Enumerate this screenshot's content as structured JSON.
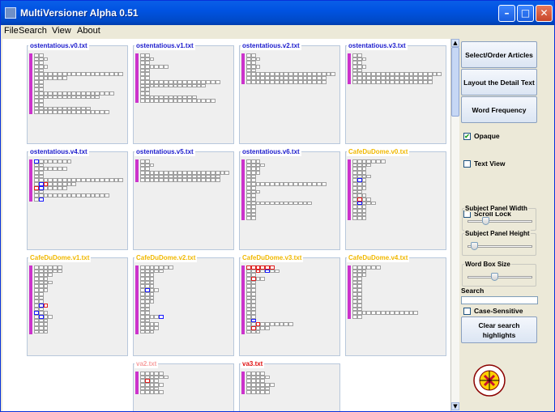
{
  "window": {
    "title": "MultiVersioner Alpha 0.51",
    "min_label": "–",
    "max_label": "□",
    "close_label": "✕"
  },
  "menu": [
    {
      "label": "File"
    },
    {
      "label": "Search"
    },
    {
      "label": "View"
    },
    {
      "label": "About"
    }
  ],
  "colors": {
    "blue_title": "#1a1acc",
    "yellow_title": "#f0b800",
    "pink_title": "#f7a0a0",
    "red_title": "#e01010",
    "marker": "#cc33cc"
  },
  "panels": [
    {
      "title": "ostentatious.v0.txt",
      "title_color": "blue",
      "rows": [
        [
          2
        ],
        [
          3
        ],
        [
          2
        ],
        [
          3
        ],
        [
          2
        ],
        [
          19
        ],
        [
          7
        ],
        [
          2
        ],
        [
          2
        ],
        [
          2
        ],
        [
          17
        ],
        [
          14
        ],
        [
          2
        ],
        [
          2
        ],
        [
          12
        ],
        [
          16
        ]
      ]
    },
    {
      "title": "ostentatious.v1.txt",
      "title_color": "blue",
      "rows": [
        [
          2
        ],
        [
          3
        ],
        [
          2
        ],
        [
          6
        ],
        [
          2,
          "b"
        ],
        [
          2
        ],
        [
          2
        ],
        [
          17
        ],
        [
          14
        ],
        [
          2
        ],
        [
          2
        ],
        [
          12
        ],
        [
          16
        ]
      ]
    },
    {
      "title": "ostentatious.v2.txt",
      "title_color": "blue",
      "rows": [
        [
          2
        ],
        [
          3
        ],
        [
          2
        ],
        [
          3
        ],
        [
          2
        ],
        [
          19
        ],
        [
          17
        ],
        [
          17
        ]
      ]
    },
    {
      "title": "ostentatious.v3.txt",
      "title_color": "blue",
      "rows": [
        [
          2
        ],
        [
          3
        ],
        [
          2
        ],
        [
          3
        ],
        [
          2
        ],
        [
          19
        ],
        [
          17
        ],
        [
          17
        ]
      ]
    },
    {
      "title": "ostentatious.v4.txt",
      "title_color": "blue",
      "rows": [
        [
          8,
          "b1"
        ],
        [
          2
        ],
        [
          7
        ],
        [
          2
        ],
        [
          2
        ],
        [
          19
        ],
        [
          9,
          "b2r3"
        ],
        [
          7,
          "r1b2"
        ],
        [
          2
        ],
        [
          16
        ],
        [
          2,
          "b2"
        ]
      ]
    },
    {
      "title": "ostentatious.v5.txt",
      "title_color": "blue",
      "rows": [
        [
          2
        ],
        [
          3
        ],
        [
          2
        ],
        [
          19
        ],
        [
          17
        ],
        [
          17
        ]
      ]
    },
    {
      "title": "ostentatious.v6.txt",
      "title_color": "blue",
      "rows": [
        [
          3
        ],
        [
          4
        ],
        [
          3
        ],
        [
          3
        ],
        [
          2
        ],
        [
          2
        ],
        [
          17
        ],
        [
          2
        ],
        [
          3
        ],
        [
          2
        ],
        [
          2
        ],
        [
          14
        ],
        [
          2
        ],
        [
          2
        ],
        [
          2
        ],
        [
          2
        ]
      ]
    },
    {
      "title": "CafeDuDome.v0.txt",
      "title_color": "yellow",
      "rows": [
        [
          7
        ],
        [
          4
        ],
        [
          3
        ],
        [
          3
        ],
        [
          4
        ],
        [
          3,
          "b2"
        ],
        [
          3
        ],
        [
          3
        ],
        [
          2
        ],
        [
          3
        ],
        [
          4,
          "r2"
        ],
        [
          5,
          "b2"
        ],
        [
          3
        ],
        [
          3
        ],
        [
          3
        ],
        [
          3
        ]
      ]
    },
    {
      "title": "CafeDuDome.v1.txt",
      "title_color": "yellow",
      "rows": [
        [
          6
        ],
        [
          6
        ],
        [
          4
        ],
        [
          3
        ],
        [
          4
        ],
        [
          3
        ],
        [
          3
        ],
        [
          2
        ],
        [
          2
        ],
        [
          2
        ],
        [
          3,
          "b2r3"
        ],
        [
          2
        ],
        [
          3,
          "b1"
        ],
        [
          4,
          "b2"
        ],
        [
          3
        ],
        [
          3
        ],
        [
          3
        ],
        [
          3
        ]
      ]
    },
    {
      "title": "CafeDuDome.v2.txt",
      "title_color": "yellow",
      "rows": [
        [
          7
        ],
        [
          5
        ],
        [
          3
        ],
        [
          3
        ],
        [
          3
        ],
        [
          3
        ],
        [
          4,
          "b2"
        ],
        [
          3
        ],
        [
          3
        ],
        [
          3
        ],
        [
          2
        ],
        [
          2
        ],
        [
          2
        ],
        [
          5,
          "b5"
        ],
        [
          2
        ],
        [
          4
        ],
        [
          4
        ],
        [
          3
        ]
      ]
    },
    {
      "title": "CafeDuDome.v3.txt",
      "title_color": "yellow",
      "rows": [
        [
          6,
          "rall"
        ],
        [
          7,
          "r3b5"
        ],
        [
          2
        ],
        [
          4,
          "r2"
        ],
        [
          2
        ],
        [
          2
        ],
        [
          2
        ],
        [
          2
        ],
        [
          2
        ],
        [
          2
        ],
        [
          2
        ],
        [
          2
        ],
        [
          2
        ],
        [
          2
        ],
        [
          2,
          "b2"
        ],
        [
          10,
          "r3"
        ],
        [
          5,
          "r2"
        ],
        [
          3
        ]
      ]
    },
    {
      "title": "CafeDuDome.v4.txt",
      "title_color": "yellow",
      "rows": [
        [
          6
        ],
        [
          3
        ],
        [
          3
        ],
        [
          2
        ],
        [
          2
        ],
        [
          2
        ],
        [
          2
        ],
        [
          2
        ],
        [
          2
        ],
        [
          2
        ],
        [
          2
        ],
        [
          2
        ],
        [
          14
        ],
        [
          2
        ]
      ]
    },
    {
      "title": "va2.txt",
      "title_color": "pink",
      "rows": [
        [
          5
        ],
        [
          6
        ],
        [
          4,
          "r2"
        ],
        [
          5
        ],
        [
          4
        ],
        [
          5
        ]
      ]
    },
    {
      "title": "va3.txt",
      "title_color": "red",
      "rows": [
        [
          4
        ],
        [
          5
        ],
        [
          4
        ],
        [
          6
        ],
        [
          5
        ],
        [
          5
        ]
      ]
    }
  ],
  "side": {
    "select_order": "Select/Order Articles",
    "layout_detail": "Layout the Detail Text",
    "word_frequency": "Word Frequency",
    "opaque": "Opaque",
    "opaque_checked": true,
    "text_view": "Text View",
    "text_view_checked": false,
    "scroll_lock": "Scroll Lock",
    "scroll_lock_checked": false,
    "subject_width": "Subject Panel Width",
    "subject_width_value": 0.25,
    "subject_height": "Subject Panel Height",
    "subject_height_value": 0.1,
    "word_box_size": "Word Box Size",
    "word_box_value": 0.4,
    "search_label": "Search",
    "search_value": "",
    "case_sensitive": "Case-Sensitive",
    "case_checked": false,
    "clear_highlights": "Clear search highlights"
  },
  "logo_text": "UNIVERSITY OF MARYLAND"
}
